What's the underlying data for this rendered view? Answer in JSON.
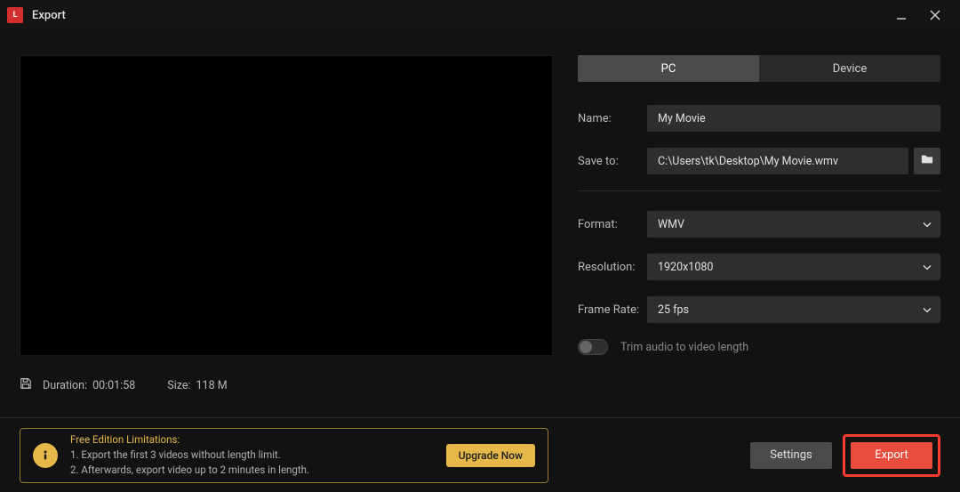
{
  "window": {
    "title": "Export"
  },
  "preview": {
    "duration_label": "Duration:",
    "duration_value": "00:01:58",
    "size_label": "Size:",
    "size_value": "118 M"
  },
  "tabs": {
    "pc": "PC",
    "device": "Device"
  },
  "form": {
    "name_label": "Name:",
    "name_value": "My Movie",
    "saveto_label": "Save to:",
    "saveto_value": "C:\\Users\\tk\\Desktop\\My Movie.wmv",
    "format_label": "Format:",
    "format_value": "WMV",
    "resolution_label": "Resolution:",
    "resolution_value": "1920x1080",
    "framerate_label": "Frame Rate:",
    "framerate_value": "25 fps",
    "trim_label": "Trim audio to video length"
  },
  "limitations": {
    "title": "Free Edition Limitations:",
    "line1": "1. Export the first 3 videos without length limit.",
    "line2": "2. Afterwards, export video up to 2 minutes in length.",
    "upgrade": "Upgrade Now"
  },
  "footer": {
    "settings": "Settings",
    "export": "Export"
  }
}
